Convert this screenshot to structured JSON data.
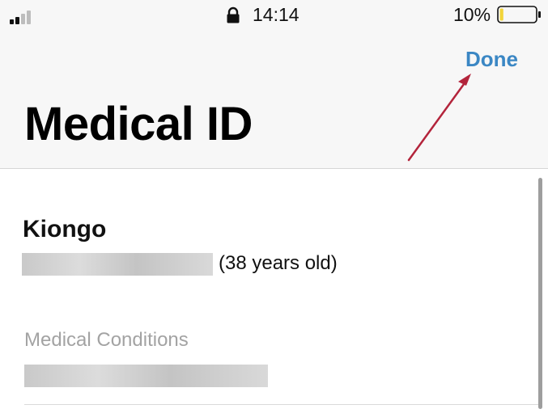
{
  "status_bar": {
    "time": "14:14",
    "battery_percent": "10%",
    "signal_icon": "cellular-signal-icon",
    "lock_icon": "orientation-lock-icon",
    "battery_icon": "battery-low-icon",
    "battery_fill_color": "#f2d43a",
    "battery_level": 0.1
  },
  "nav": {
    "done_label": "Done",
    "done_color": "#3b87c4"
  },
  "page": {
    "title": "Medical ID"
  },
  "profile": {
    "name": "Kiongo",
    "age_text": "(38 years old)"
  },
  "sections": {
    "medical_conditions_label": "Medical Conditions"
  },
  "annotation": {
    "arrow_color": "#b3243b",
    "points_to": "Done"
  }
}
